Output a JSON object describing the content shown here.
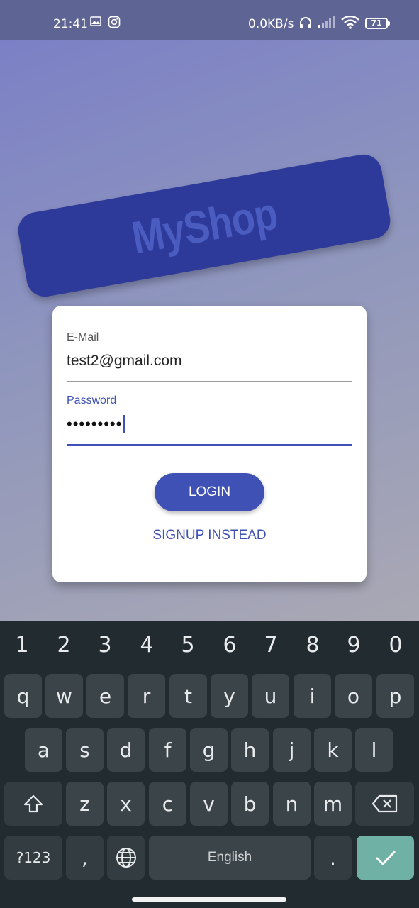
{
  "status_bar": {
    "time": "21:41",
    "network_speed": "0.0KB/s",
    "battery": "71",
    "icons": [
      "gallery-icon",
      "instagram-icon",
      "headphones-icon",
      "signal-icon",
      "wifi-icon",
      "battery-icon"
    ]
  },
  "app": {
    "brand": "MyShop",
    "colors": {
      "primary": "#3f51b5",
      "banner": "#2e3a9a"
    }
  },
  "auth": {
    "email_label": "E-Mail",
    "email_value": "test2@gmail.com",
    "password_label": "Password",
    "password_mask": "•••••••••",
    "login_label": "LOGIN",
    "signup_label": "SIGNUP INSTEAD"
  },
  "keyboard": {
    "number_row": [
      "1",
      "2",
      "3",
      "4",
      "5",
      "6",
      "7",
      "8",
      "9",
      "0"
    ],
    "row1": [
      "q",
      "w",
      "e",
      "r",
      "t",
      "y",
      "u",
      "i",
      "o",
      "p"
    ],
    "row2": [
      "a",
      "s",
      "d",
      "f",
      "g",
      "h",
      "j",
      "k",
      "l"
    ],
    "row3": [
      "z",
      "x",
      "c",
      "v",
      "b",
      "n",
      "m"
    ],
    "symbols_label": "?123",
    "comma_label": ",",
    "space_label": "English",
    "period_label": ".",
    "icons": [
      "shift-icon",
      "backspace-icon",
      "globe-icon",
      "checkmark-icon"
    ],
    "enter_color": "#6fb1a5"
  }
}
